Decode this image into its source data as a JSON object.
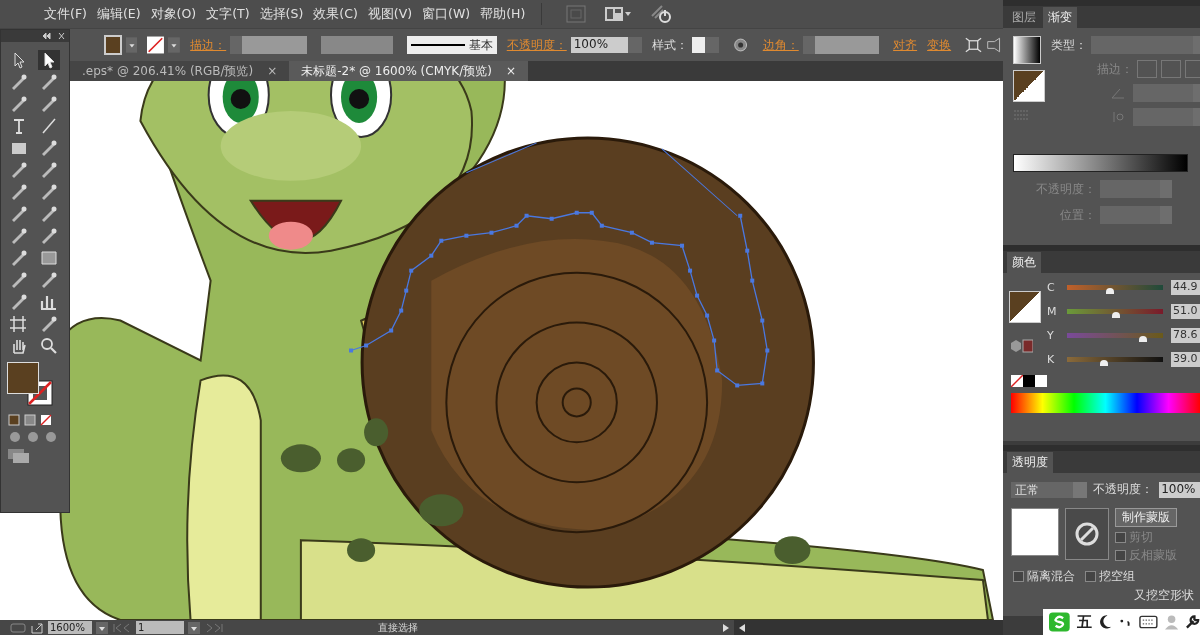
{
  "menu": [
    "文件(F)",
    "编辑(E)",
    "对象(O)",
    "文字(T)",
    "选择(S)",
    "效果(C)",
    "视图(V)",
    "窗口(W)",
    "帮助(H)"
  ],
  "control_bar": {
    "stroke_label": "描边：",
    "stroke_style": "基本",
    "opacity_label": "不透明度：",
    "opacity": "100%",
    "style_label": "样式：",
    "corner_label": "边角：",
    "align": "对齐",
    "transform": "变换"
  },
  "tabs": [
    {
      "label": ".eps* @ 206.41% (RGB/预览)",
      "close": "×",
      "selected": false
    },
    {
      "label": "未标题-2* @ 1600% (CMYK/预览)",
      "close": "×",
      "selected": true
    }
  ],
  "gradient_panel": {
    "tabs": [
      {
        "label": "图层",
        "selected": false
      },
      {
        "label": "渐变",
        "selected": true
      }
    ],
    "type_label": "类型：",
    "stroke_label": "描边：",
    "opacity_label": "不透明度：",
    "position_label": "位置："
  },
  "color_panel": {
    "title": "颜色",
    "channels": [
      {
        "name": "C",
        "level": 0.45,
        "value": "44.9"
      },
      {
        "name": "M",
        "level": 0.51,
        "value": "51.0"
      },
      {
        "name": "Y",
        "level": 0.79,
        "value": "78.6"
      },
      {
        "name": "K",
        "level": 0.39,
        "value": "39.0"
      }
    ]
  },
  "transparency_panel": {
    "title": "透明度",
    "mode": "正常",
    "opacity_label": "不透明度：",
    "opacity": "100%",
    "mask_button": "制作蒙版",
    "options": [
      {
        "label": "剪切",
        "checked": false,
        "disabled": true
      },
      {
        "label": "反相蒙版",
        "checked": false,
        "disabled": true
      },
      {
        "label": "隔离混合",
        "checked": false,
        "disabled": false
      },
      {
        "label": "挖空组",
        "checked": false,
        "disabled": false
      }
    ],
    "knockout_label": "又挖空形状"
  },
  "status_bar": {
    "zoom": "1600%",
    "page": "1",
    "tool": "直接选择"
  },
  "ime_bar": {
    "mode": "五"
  }
}
